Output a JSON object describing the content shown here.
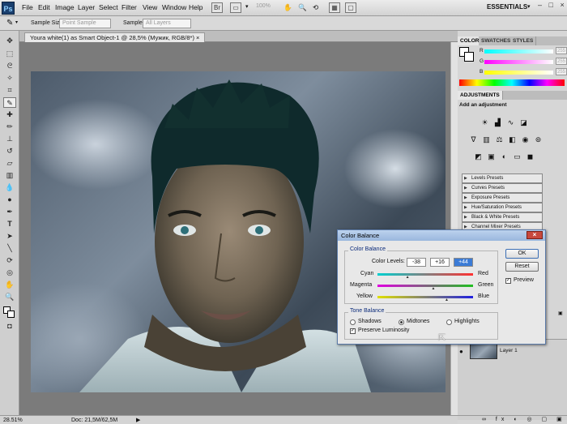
{
  "app": {
    "logo": "Ps",
    "menu": [
      "File",
      "Edit",
      "Image",
      "Layer",
      "Select",
      "Filter",
      "View",
      "Window",
      "Help"
    ],
    "zoom": "100%",
    "workspace": "ESSENTIALS",
    "window_controls": "– □ ×"
  },
  "options_bar": {
    "sample_size_label": "Sample Size:",
    "sample_size_value": "Point Sample",
    "sample_label": "Sample:",
    "sample_value": "All Layers"
  },
  "document": {
    "tab_title": "Youra white(1) as Smart Object-1 @ 28,5% (Мужик, RGB/8*) ×",
    "status_zoom": "28.51%",
    "status_doc": "Doc: 21,5M/62,5M"
  },
  "color_panel": {
    "tabs": [
      "COLOR",
      "SWATCHES",
      "STYLES"
    ],
    "channels": [
      {
        "label": "R",
        "value": "255"
      },
      {
        "label": "G",
        "value": "255"
      },
      {
        "label": "B",
        "value": "255"
      }
    ]
  },
  "adjustments_panel": {
    "tab": "ADJUSTMENTS",
    "subtitle": "Add an adjustment",
    "presets": [
      "Levels Presets",
      "Curves Presets",
      "Exposure Presets",
      "Hue/Saturation Presets",
      "Black & White Presets",
      "Channel Mixer Presets"
    ]
  },
  "layers_panel": {
    "layer_name": "Layer 1"
  },
  "dialog": {
    "title": "Color Balance",
    "color_balance_group": "Color Balance",
    "color_levels_label": "Color Levels:",
    "levels": [
      "-38",
      "+16",
      "+44"
    ],
    "sliders": [
      {
        "left": "Cyan",
        "right": "Red",
        "position": 0.31
      },
      {
        "left": "Magenta",
        "right": "Green",
        "position": 0.58
      },
      {
        "left": "Yellow",
        "right": "Blue",
        "position": 0.72
      }
    ],
    "tone_balance_group": "Tone Balance",
    "tones": [
      "Shadows",
      "Midtones",
      "Highlights"
    ],
    "selected_tone": "Midtones",
    "preserve_luminosity": "Preserve Luminosity",
    "preserve_checked": true,
    "ok": "OK",
    "reset": "Reset",
    "preview": "Preview",
    "preview_checked": true
  }
}
